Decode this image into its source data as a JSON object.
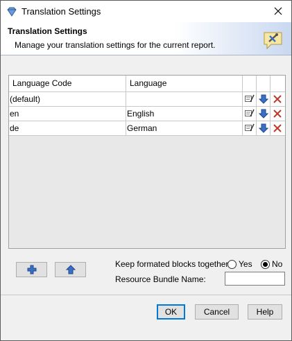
{
  "window": {
    "title": "Translation Settings"
  },
  "banner": {
    "title": "Translation Settings",
    "description": "Manage your translation settings for the current report."
  },
  "table": {
    "columns": [
      "Language Code",
      "Language"
    ],
    "rows": [
      {
        "code": "(default)",
        "language": ""
      },
      {
        "code": "en",
        "language": "English"
      },
      {
        "code": "de",
        "language": "German"
      }
    ]
  },
  "options": {
    "keep_blocks_label": "Keep formated blocks together:",
    "yes_label": "Yes",
    "no_label": "No",
    "keep_blocks_value": "No",
    "bundle_label": "Resource Bundle Name:",
    "bundle_value": ""
  },
  "buttons": {
    "ok": "OK",
    "cancel": "Cancel",
    "help": "Help"
  },
  "icons": {
    "app": "diamond-icon",
    "banner": "speech-bubble-tools-icon",
    "close": "close-icon",
    "add": "plus-icon",
    "move_up": "arrow-up-icon",
    "edit": "edit-icon",
    "move_down": "arrow-down-icon",
    "delete": "delete-icon"
  },
  "colors": {
    "accent": "#0078d7",
    "icon_blue": "#3b6fc4",
    "delete_red": "#c0392b"
  }
}
